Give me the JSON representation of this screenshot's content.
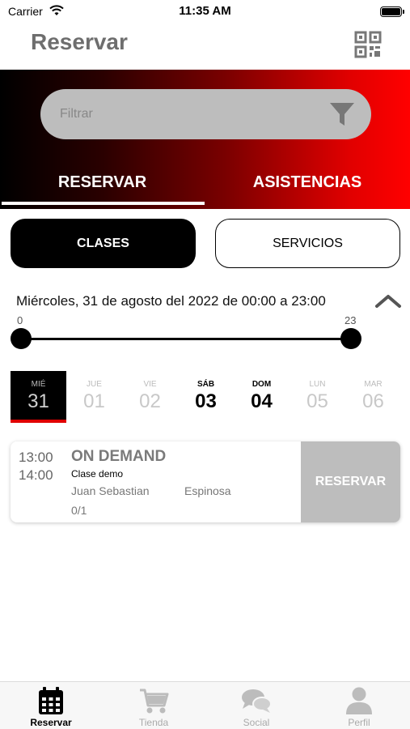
{
  "status_bar": {
    "carrier": "Carrier",
    "time": "11:35 AM"
  },
  "header": {
    "title": "Reservar",
    "qr_icon": "qr-code-icon"
  },
  "filter": {
    "placeholder": "Filtrar",
    "icon": "filter-icon"
  },
  "top_tabs": [
    {
      "label": "RESERVAR",
      "active": true
    },
    {
      "label": "ASISTENCIAS",
      "active": false
    }
  ],
  "segments": [
    {
      "label": "CLASES",
      "active": true
    },
    {
      "label": "SERVICIOS",
      "active": false
    }
  ],
  "date_range": {
    "label": "Miércoles, 31 de agosto del 2022 de 00:00 a 23:00",
    "slider_min": "0",
    "slider_max": "23",
    "selected_range": [
      0,
      23
    ]
  },
  "days": [
    {
      "name": "MIÉ",
      "number": "31",
      "state": "selected"
    },
    {
      "name": "JUE",
      "number": "01",
      "state": "disabled"
    },
    {
      "name": "VIE",
      "number": "02",
      "state": "disabled"
    },
    {
      "name": "SÁB",
      "number": "03",
      "state": "enabled"
    },
    {
      "name": "DOM",
      "number": "04",
      "state": "enabled"
    },
    {
      "name": "LUN",
      "number": "05",
      "state": "disabled"
    },
    {
      "name": "MAR",
      "number": "06",
      "state": "disabled"
    }
  ],
  "classes": [
    {
      "start": "13:00",
      "end": "14:00",
      "title": "ON DEMAND",
      "subtitle": "Clase demo",
      "instructor_first": "Juan Sebastian",
      "instructor_last": "Espinosa",
      "capacity": "0/1",
      "action": "RESERVAR"
    }
  ],
  "bottom_tabs": [
    {
      "label": "Reservar",
      "icon": "calendar-icon",
      "active": true
    },
    {
      "label": "Tienda",
      "icon": "cart-icon",
      "active": false
    },
    {
      "label": "Social",
      "icon": "chat-bubbles-icon",
      "active": false
    },
    {
      "label": "Perfil",
      "icon": "user-icon",
      "active": false
    }
  ],
  "colors": {
    "accent": "#e00000",
    "gradient_start": "#000000",
    "gradient_end": "#ff0000",
    "disabled_gray": "#bdbdbd"
  }
}
